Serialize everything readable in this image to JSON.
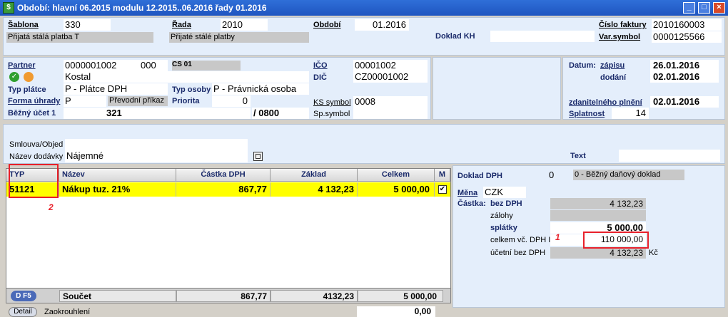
{
  "window": {
    "title": "Období: hlavní 06.2015 modulu 12.2015..06.2016 řady 01.2016"
  },
  "header": {
    "sablona_label": "Šablona",
    "sablona_value": "330",
    "sablona_desc": "Přijatá stálá platba T",
    "rada_label": "Řada",
    "rada_value": "2010",
    "rada_desc": "Přijaté stálé platby",
    "obdobi_label": "Období",
    "obdobi_value": "01.2016",
    "doklad_kh_label": "Doklad KH",
    "cislo_faktury_label": "Číslo faktury",
    "cislo_faktury_value": "2010160003",
    "var_symbol_label": "Var.symbol",
    "var_symbol_value": "0000125566"
  },
  "partner": {
    "partner_label": "Partner",
    "partner_value": "0000001002",
    "partner_sub": "000",
    "cs_label": "CS 01",
    "name": "Kostal",
    "typ_platce_label": "Typ plátce",
    "typ_platce_value": "P - Plátce DPH",
    "typ_osoby_label": "Typ osoby",
    "typ_osoby_value": "P - Právnická osoba",
    "forma_uhrady_label": "Forma úhrady",
    "forma_uhrady_value": "P",
    "forma_uhrady_desc": "Převodní příkaz",
    "priorita_label": "Priorita",
    "priorita_value": "0",
    "bezny_ucet_label": "Běžný účet 1",
    "bezny_ucet_value": "321",
    "bank_code": "/ 0800",
    "ico_label": "IČO",
    "ico_value": "00001002",
    "dic_label": "DIČ",
    "dic_value": "CZ00001002",
    "ks_symbol_label": "KS symbol",
    "ks_symbol_value": "0008",
    "sp_symbol_label": "Sp.symbol"
  },
  "dates": {
    "datum_label": "Datum:",
    "zapisu_label": "zápisu",
    "zapisu_value": "26.01.2016",
    "dodani_label": "dodání",
    "dodani_value": "02.01.2016",
    "zdp_label": "zdanitelného plnění",
    "zdp_value": "02.01.2016",
    "splatnost_label": "Splatnost",
    "splatnost_value": "14"
  },
  "contract": {
    "smlouva_label": "Smlouva/Objed",
    "nazev_dodavky_label": "Název dodávky",
    "nazev_dodavky_value": "Nájemné",
    "text_label": "Text"
  },
  "grid": {
    "columns": [
      "TYP",
      "Název",
      "Částka DPH",
      "Základ",
      "Celkem",
      "M"
    ],
    "rows": [
      {
        "typ": "51121",
        "nazev": "Nákup tuz. 21%",
        "castka_dph": "867,77",
        "zaklad": "4 132,23",
        "celkem": "5 000,00",
        "m": "✔"
      }
    ],
    "footer": {
      "nav": "D F5",
      "label": "Součet",
      "castka_dph": "867,77",
      "zaklad": "4132,23",
      "celkem": "5 000,00"
    }
  },
  "bottom": {
    "detail_label": "Detail",
    "zaokrouhleni_label": "Zaokrouhlení",
    "zaokrouhleni_value": "0,00"
  },
  "dph": {
    "doklad_dph_label": "Doklad DPH",
    "doklad_dph_value": "0",
    "doklad_dph_desc": "0 - Běžný daňový doklad",
    "mena_label": "Měna",
    "mena_value": "CZK",
    "castka_label": "Částka:",
    "bez_dph_label": "bez DPH",
    "bez_dph_value": "4 132,23",
    "zalohy_label": "zálohy",
    "splatky_label": "splátky",
    "splatky_value": "5 000,00",
    "celkem_label": "celkem vč. DPH I",
    "celkem_value": "110 000,00",
    "ucetni_label": "účetní bez DPH",
    "ucetni_value": "4 132,23",
    "ucetni_currency": "Kč"
  },
  "annotations": {
    "mark1": "1",
    "mark2": "2"
  },
  "colors": {
    "titlebar": "#1f55c0",
    "panel": "#e4eefb",
    "highlight": "#ffff00",
    "annotation": "#e8202a"
  }
}
